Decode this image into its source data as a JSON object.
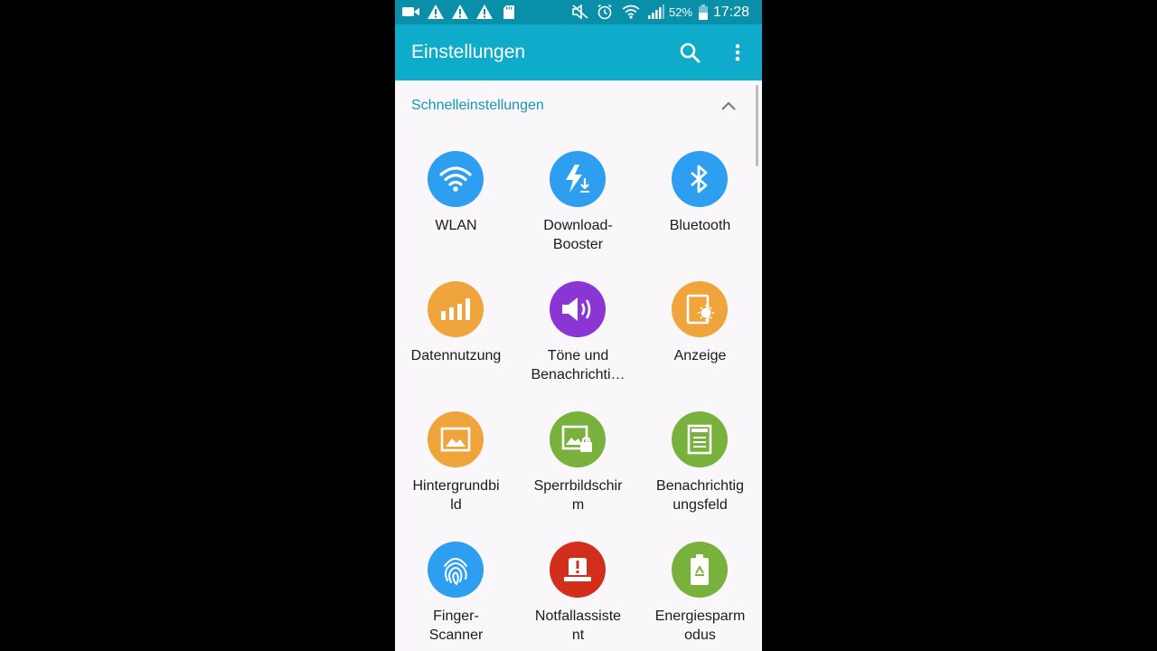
{
  "status_bar": {
    "battery_percent": "52%",
    "time": "17:28",
    "icons": [
      "video-camera-icon",
      "warning-icon",
      "warning-icon",
      "warning-icon",
      "sd-card-icon",
      "mute-icon",
      "alarm-icon",
      "wifi-icon",
      "signal-icon",
      "battery-icon"
    ]
  },
  "app_bar": {
    "title": "Einstellungen",
    "actions": [
      "search-icon",
      "more-vert-icon"
    ]
  },
  "section": {
    "title": "Schnelleinstellungen",
    "toggle_icon": "chevron-up-icon"
  },
  "colors": {
    "status_bar": "#0a8fa9",
    "app_bar": "#0fabcb",
    "accent_text": "#169aae",
    "blue": "#2e9ff0",
    "orange": "#efa53c",
    "purple": "#8c35d5",
    "green": "#78b23d",
    "red": "#d12f1b"
  },
  "tiles": [
    {
      "label": "WLAN",
      "icon": "wifi-icon",
      "color": "#2e9ff0"
    },
    {
      "label": "Download-\nBooster",
      "icon": "download-booster-icon",
      "color": "#2e9ff0"
    },
    {
      "label": "Bluetooth",
      "icon": "bluetooth-icon",
      "color": "#2e9ff0"
    },
    {
      "label": "Datennutzung",
      "icon": "data-usage-icon",
      "color": "#efa53c"
    },
    {
      "label": "Töne und\nBenachrichti…",
      "icon": "sound-icon",
      "color": "#8c35d5"
    },
    {
      "label": "Anzeige",
      "icon": "display-icon",
      "color": "#efa53c"
    },
    {
      "label": "Hintergrundbi\nld",
      "icon": "wallpaper-icon",
      "color": "#efa53c"
    },
    {
      "label": "Sperrbildschir\nm",
      "icon": "lockscreen-icon",
      "color": "#78b23d"
    },
    {
      "label": "Benachrichtig\nungsfeld",
      "icon": "notification-panel-icon",
      "color": "#78b23d"
    },
    {
      "label": "Finger-\nScanner",
      "icon": "fingerprint-icon",
      "color": "#2e9ff0"
    },
    {
      "label": "Notfallassiste\nnt",
      "icon": "emergency-icon",
      "color": "#d12f1b"
    },
    {
      "label": "Energiesparm\nodus",
      "icon": "power-saving-icon",
      "color": "#78b23d"
    }
  ]
}
